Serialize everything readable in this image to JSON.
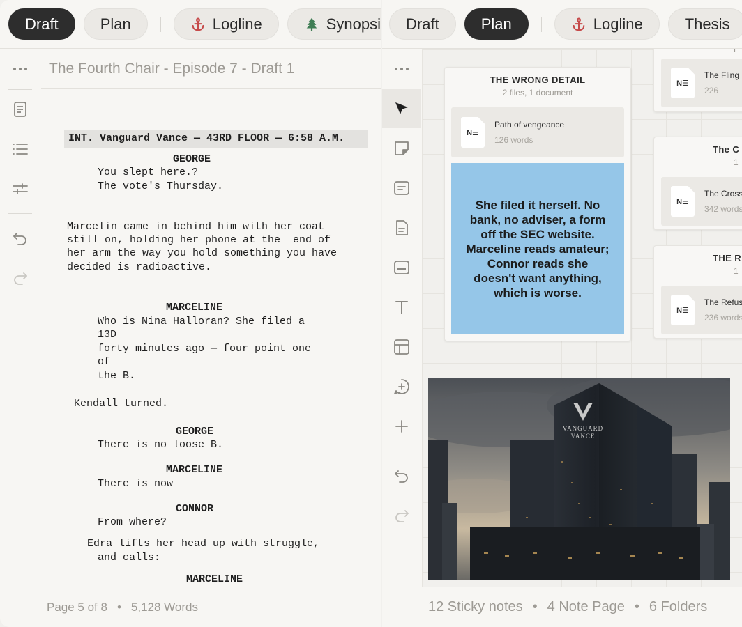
{
  "colors": {
    "active_pill": "#2d2d2d",
    "sticky_note": "#95c6e8",
    "logline_icon": "#c64a4a",
    "synopsis_icon": "#3f7d54"
  },
  "left": {
    "tabs": [
      {
        "label": "Draft",
        "active": true
      },
      {
        "label": "Plan",
        "active": false
      },
      {
        "label": "Logline",
        "icon": "anchor-icon"
      },
      {
        "label": "Synopsis",
        "icon": "tree-icon"
      }
    ],
    "doc_title": "The Fourth Chair - Episode 7 - Draft 1",
    "script": {
      "slugline": "INT. Vanguard Vance — 43RD FLOOR — 6:58 A.M.",
      "lines": [
        "GEORGE",
        "You slept here.?",
        "The vote's Thursday.",
        "Marcelin came in behind him with her coat",
        "still on, holding her phone at the  end of",
        "her arm the way you hold something you have",
        "decided is radioactive.",
        "MARCELINE",
        "Who is Nina Halloran? She filed a",
        "13D",
        "forty minutes ago — four point one",
        "of",
        "the B.",
        "Kendall turned.",
        "GEORGE",
        "There is no loose B.",
        "MARCELINE",
        "There is now",
        "CONNOR",
        "From where?",
        "Edra lifts her head up with struggle,",
        "and calls:",
        "MARCELINE"
      ]
    },
    "footer": {
      "page": "Page 5 of 8",
      "words": "5,128 Words"
    }
  },
  "right": {
    "tabs": [
      {
        "label": "Draft",
        "active": false
      },
      {
        "label": "Plan",
        "active": true
      },
      {
        "label": "Logline",
        "icon": "anchor-icon"
      },
      {
        "label": "Thesis"
      }
    ],
    "folders": [
      {
        "title": "THE WRONG DETAIL",
        "meta": "2 files, 1 document",
        "file": {
          "name": "Path of vengeance",
          "words": "126 words"
        }
      },
      {
        "title": "",
        "meta": "1",
        "file": {
          "name": "The Fling",
          "words": "226"
        }
      },
      {
        "title": "The C",
        "meta": "1",
        "file": {
          "name": "The Cross",
          "words": "342 words"
        }
      },
      {
        "title": "THE R",
        "meta": "1",
        "file": {
          "name": "The Refus",
          "words": "236 words"
        }
      }
    ],
    "file_icon_label": "N☰",
    "sticky_note": "She filed it herself. No bank, no adviser, a form off the SEC website. Marceline reads amateur; Connor reads she doesn't want anything, which is worse.",
    "building_sign": {
      "line1": "VANGUARD",
      "line2": "VANCE"
    },
    "footer": {
      "sticky": "12 Sticky notes",
      "notes": "4 Note Page",
      "folders": "6 Folders"
    }
  }
}
